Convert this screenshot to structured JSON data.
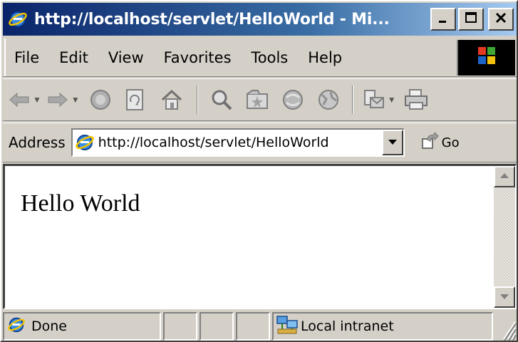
{
  "window": {
    "title": "http://localhost/servlet/HelloWorld - Mi...",
    "title_icon": "ie-logo-icon",
    "controls": [
      "minimize-icon",
      "maximize-icon",
      "close-icon"
    ]
  },
  "menu": {
    "items": [
      {
        "label": "File"
      },
      {
        "label": "Edit"
      },
      {
        "label": "View"
      },
      {
        "label": "Favorites"
      },
      {
        "label": "Tools"
      },
      {
        "label": "Help"
      }
    ],
    "throbber_icon": "windows-logo-icon"
  },
  "toolbar": {
    "buttons": [
      "back-icon",
      "forward-icon",
      "stop-icon",
      "refresh-icon",
      "home-icon",
      "search-icon",
      "favorites-icon",
      "history-icon",
      "media-icon",
      "mail-icon",
      "print-icon"
    ]
  },
  "address": {
    "label": "Address",
    "value": "http://localhost/servlet/HelloWorld",
    "go_label": "Go"
  },
  "content": {
    "text": "Hello World"
  },
  "status": {
    "text": "Done",
    "zone": "Local intranet"
  },
  "colors": {
    "titlebar_start": "#0a246a",
    "titlebar_end": "#a6caf0",
    "chrome": "#d4d0c8"
  }
}
